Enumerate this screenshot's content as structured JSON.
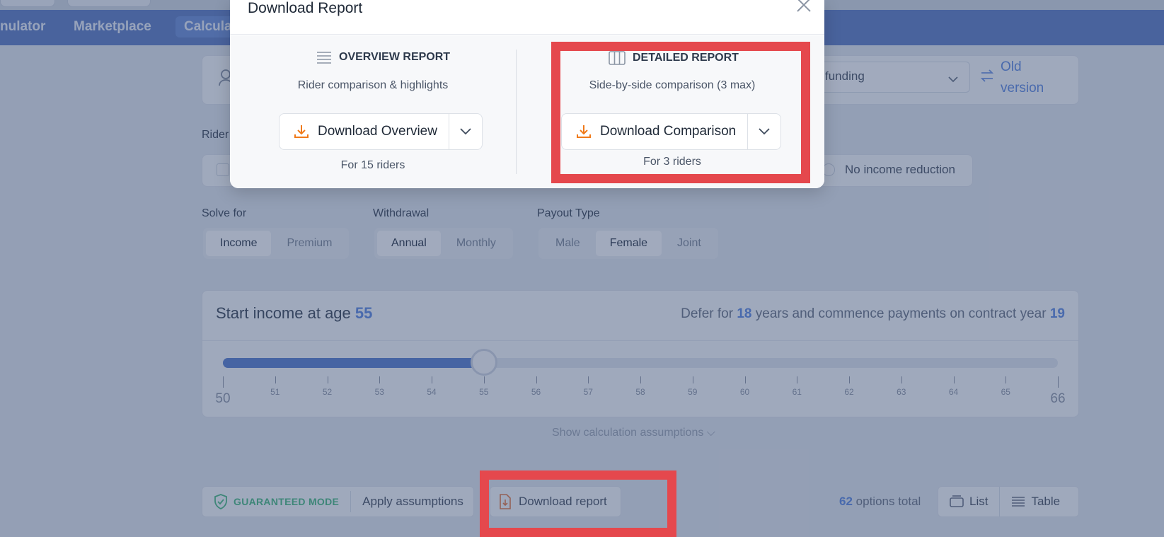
{
  "nav": {
    "items": [
      "nulator",
      "Marketplace",
      "Calcula"
    ]
  },
  "filters": {
    "funding_value": "funding",
    "old_version": "Old version",
    "rider_label": "Rider",
    "no_income_reduction": "No income reduction"
  },
  "solve_for": {
    "label": "Solve for",
    "options": [
      "Income",
      "Premium"
    ],
    "selected": "Income"
  },
  "withdrawal": {
    "label": "Withdrawal",
    "options": [
      "Annual",
      "Monthly"
    ],
    "selected": "Annual"
  },
  "payout_type": {
    "label": "Payout Type",
    "options": [
      "Male",
      "Female",
      "Joint"
    ],
    "selected": "Female"
  },
  "income": {
    "title_prefix": "Start income at age",
    "age": "55",
    "defer_prefix": "Defer for",
    "defer_years": "18",
    "defer_middle": "years and commence payments on contract year",
    "contract_year": "19",
    "slider": {
      "min": 50,
      "max": 66,
      "value": 55
    },
    "tick_labels": [
      "50",
      "51",
      "52",
      "53",
      "54",
      "55",
      "56",
      "57",
      "58",
      "59",
      "60",
      "61",
      "62",
      "63",
      "64",
      "65",
      "66"
    ]
  },
  "assumptions_link": "Show calculation assumptions",
  "toolbar": {
    "guaranteed_mode": "GUARANTEED MODE",
    "apply_assumptions": "Apply assumptions",
    "download_report": "Download report",
    "options_count": "62",
    "options_suffix": "options total",
    "list": "List",
    "table": "Table"
  },
  "modal": {
    "title": "Download Report",
    "overview": {
      "heading": "OVERVIEW REPORT",
      "subtitle": "Rider comparison & highlights",
      "button": "Download Overview",
      "count": "For 15 riders"
    },
    "detailed": {
      "heading": "DETAILED REPORT",
      "subtitle": "Side-by-side comparison (3 max)",
      "button": "Download Comparison",
      "count": "For 3 riders"
    }
  },
  "colors": {
    "accent_orange": "#f07a1a",
    "highlight_red": "#e5484d",
    "nav_blue": "#5f7fc4",
    "link_blue": "#5f8be0",
    "guaranteed_green": "#4dba86"
  }
}
